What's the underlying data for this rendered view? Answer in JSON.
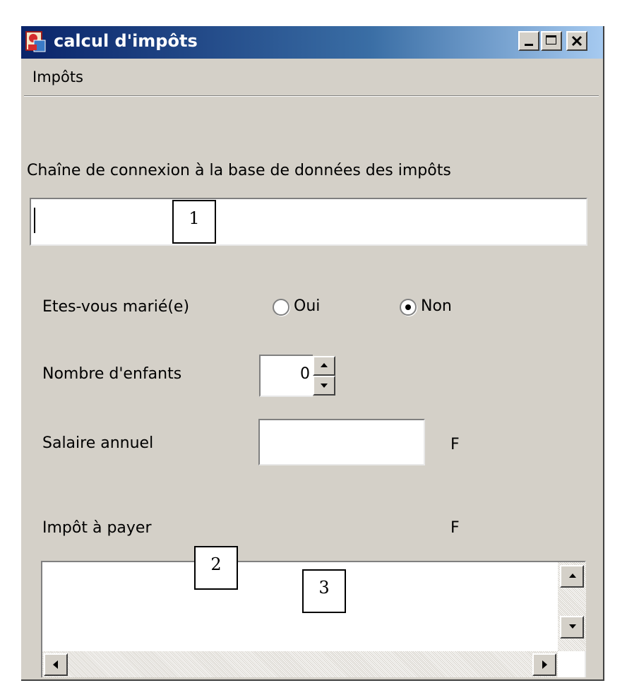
{
  "window": {
    "title": "calcul d'impôts",
    "controls": {
      "minimize_icon": "minimize-icon",
      "maximize_icon": "maximize-icon",
      "close_icon": "close-icon"
    }
  },
  "menu": {
    "items": [
      "Impôts"
    ]
  },
  "connection": {
    "label": "Chaîne de connexion à la base de données des impôts",
    "value": ""
  },
  "marital": {
    "label": "Etes-vous marié(e)",
    "options": [
      {
        "label": "Oui",
        "selected": false
      },
      {
        "label": "Non",
        "selected": true
      }
    ]
  },
  "children": {
    "label": "Nombre d'enfants",
    "value": "0"
  },
  "salary": {
    "label": "Salaire annuel",
    "value": "",
    "unit": "F"
  },
  "tax": {
    "label": "Impôt à payer",
    "unit": "F",
    "output": ""
  },
  "callouts": [
    "1",
    "2",
    "3"
  ]
}
